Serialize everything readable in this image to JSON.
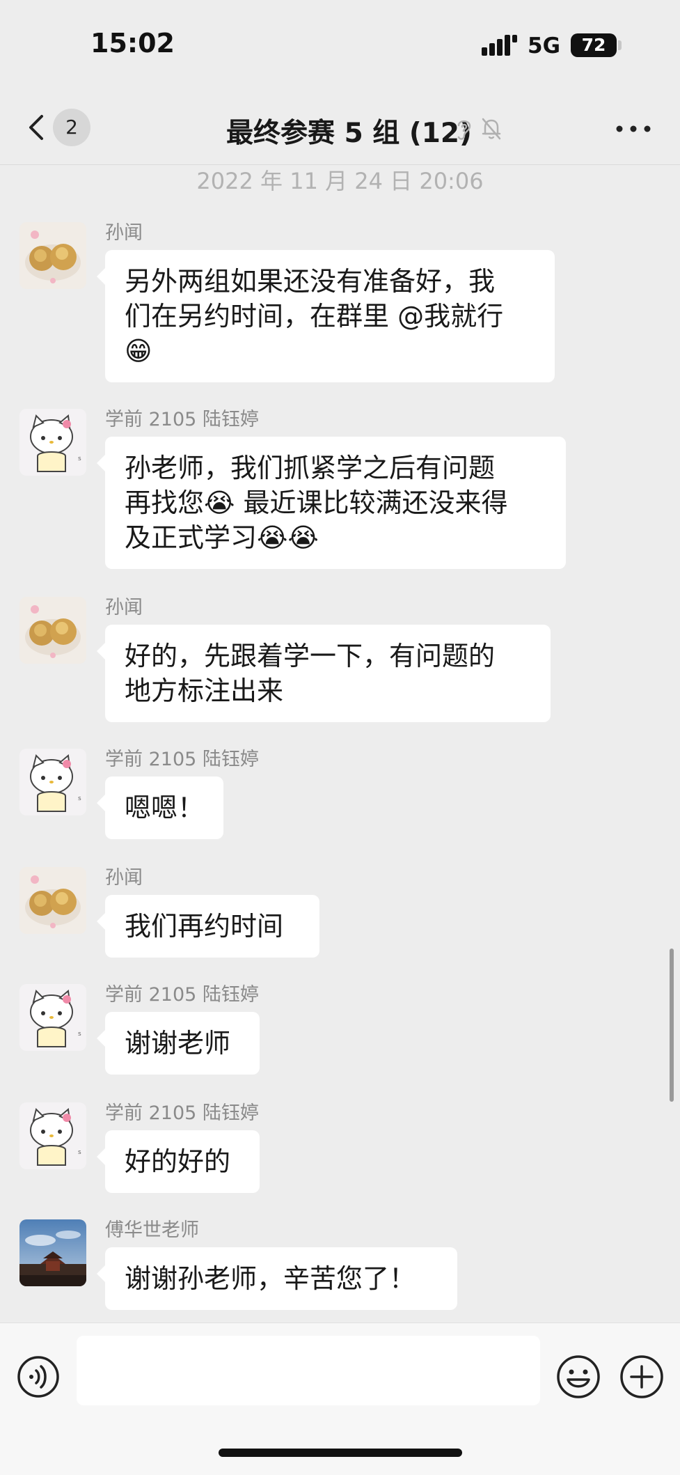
{
  "status_bar": {
    "time": "15:02",
    "network": "5G",
    "battery_level": "72",
    "battery_fraction": 0.72
  },
  "nav": {
    "unread_count": "2",
    "title": "最终参赛 5 组 (12)"
  },
  "chat": {
    "timestamp": "2022 年 11 月 24 日  20:06",
    "messages": [
      {
        "sender": "孙闻",
        "avatar": "bread-avatar",
        "lines": [
          "另外两组如果还没有准备好，我",
          "们在另约时间，在群里 @我就行",
          "😁"
        ]
      },
      {
        "sender": "学前 2105 陆钰婷",
        "avatar": "hello-kitty-avatar",
        "lines": [
          "孙老师，我们抓紧学之后有问题",
          "再找您😭 最近课比较满还没来得",
          "及正式学习😭😭"
        ]
      },
      {
        "sender": "孙闻",
        "avatar": "bread-avatar",
        "lines": [
          "好的，先跟着学一下，有问题的",
          "地方标注出来"
        ]
      },
      {
        "sender": "学前 2105 陆钰婷",
        "avatar": "hello-kitty-avatar",
        "lines": [
          "嗯嗯！"
        ]
      },
      {
        "sender": "孙闻",
        "avatar": "bread-avatar",
        "lines": [
          "我们再约时间"
        ]
      },
      {
        "sender": "学前 2105 陆钰婷",
        "avatar": "hello-kitty-avatar",
        "lines": [
          "谢谢老师"
        ]
      },
      {
        "sender": "学前 2105 陆钰婷",
        "avatar": "hello-kitty-avatar",
        "lines": [
          "好的好的"
        ]
      },
      {
        "sender": "傅华世老师",
        "avatar": "landscape-avatar",
        "lines": [
          "谢谢孙老师，辛苦您了！"
        ]
      }
    ]
  },
  "input": {
    "value": "",
    "placeholder": ""
  },
  "icons": {
    "back": "chevron-left-icon",
    "ear": "ear-icon",
    "mute": "bell-muted-icon",
    "more": "more-dots-icon",
    "voice": "voice-icon",
    "emoji": "emoji-icon",
    "add": "plus-icon"
  }
}
